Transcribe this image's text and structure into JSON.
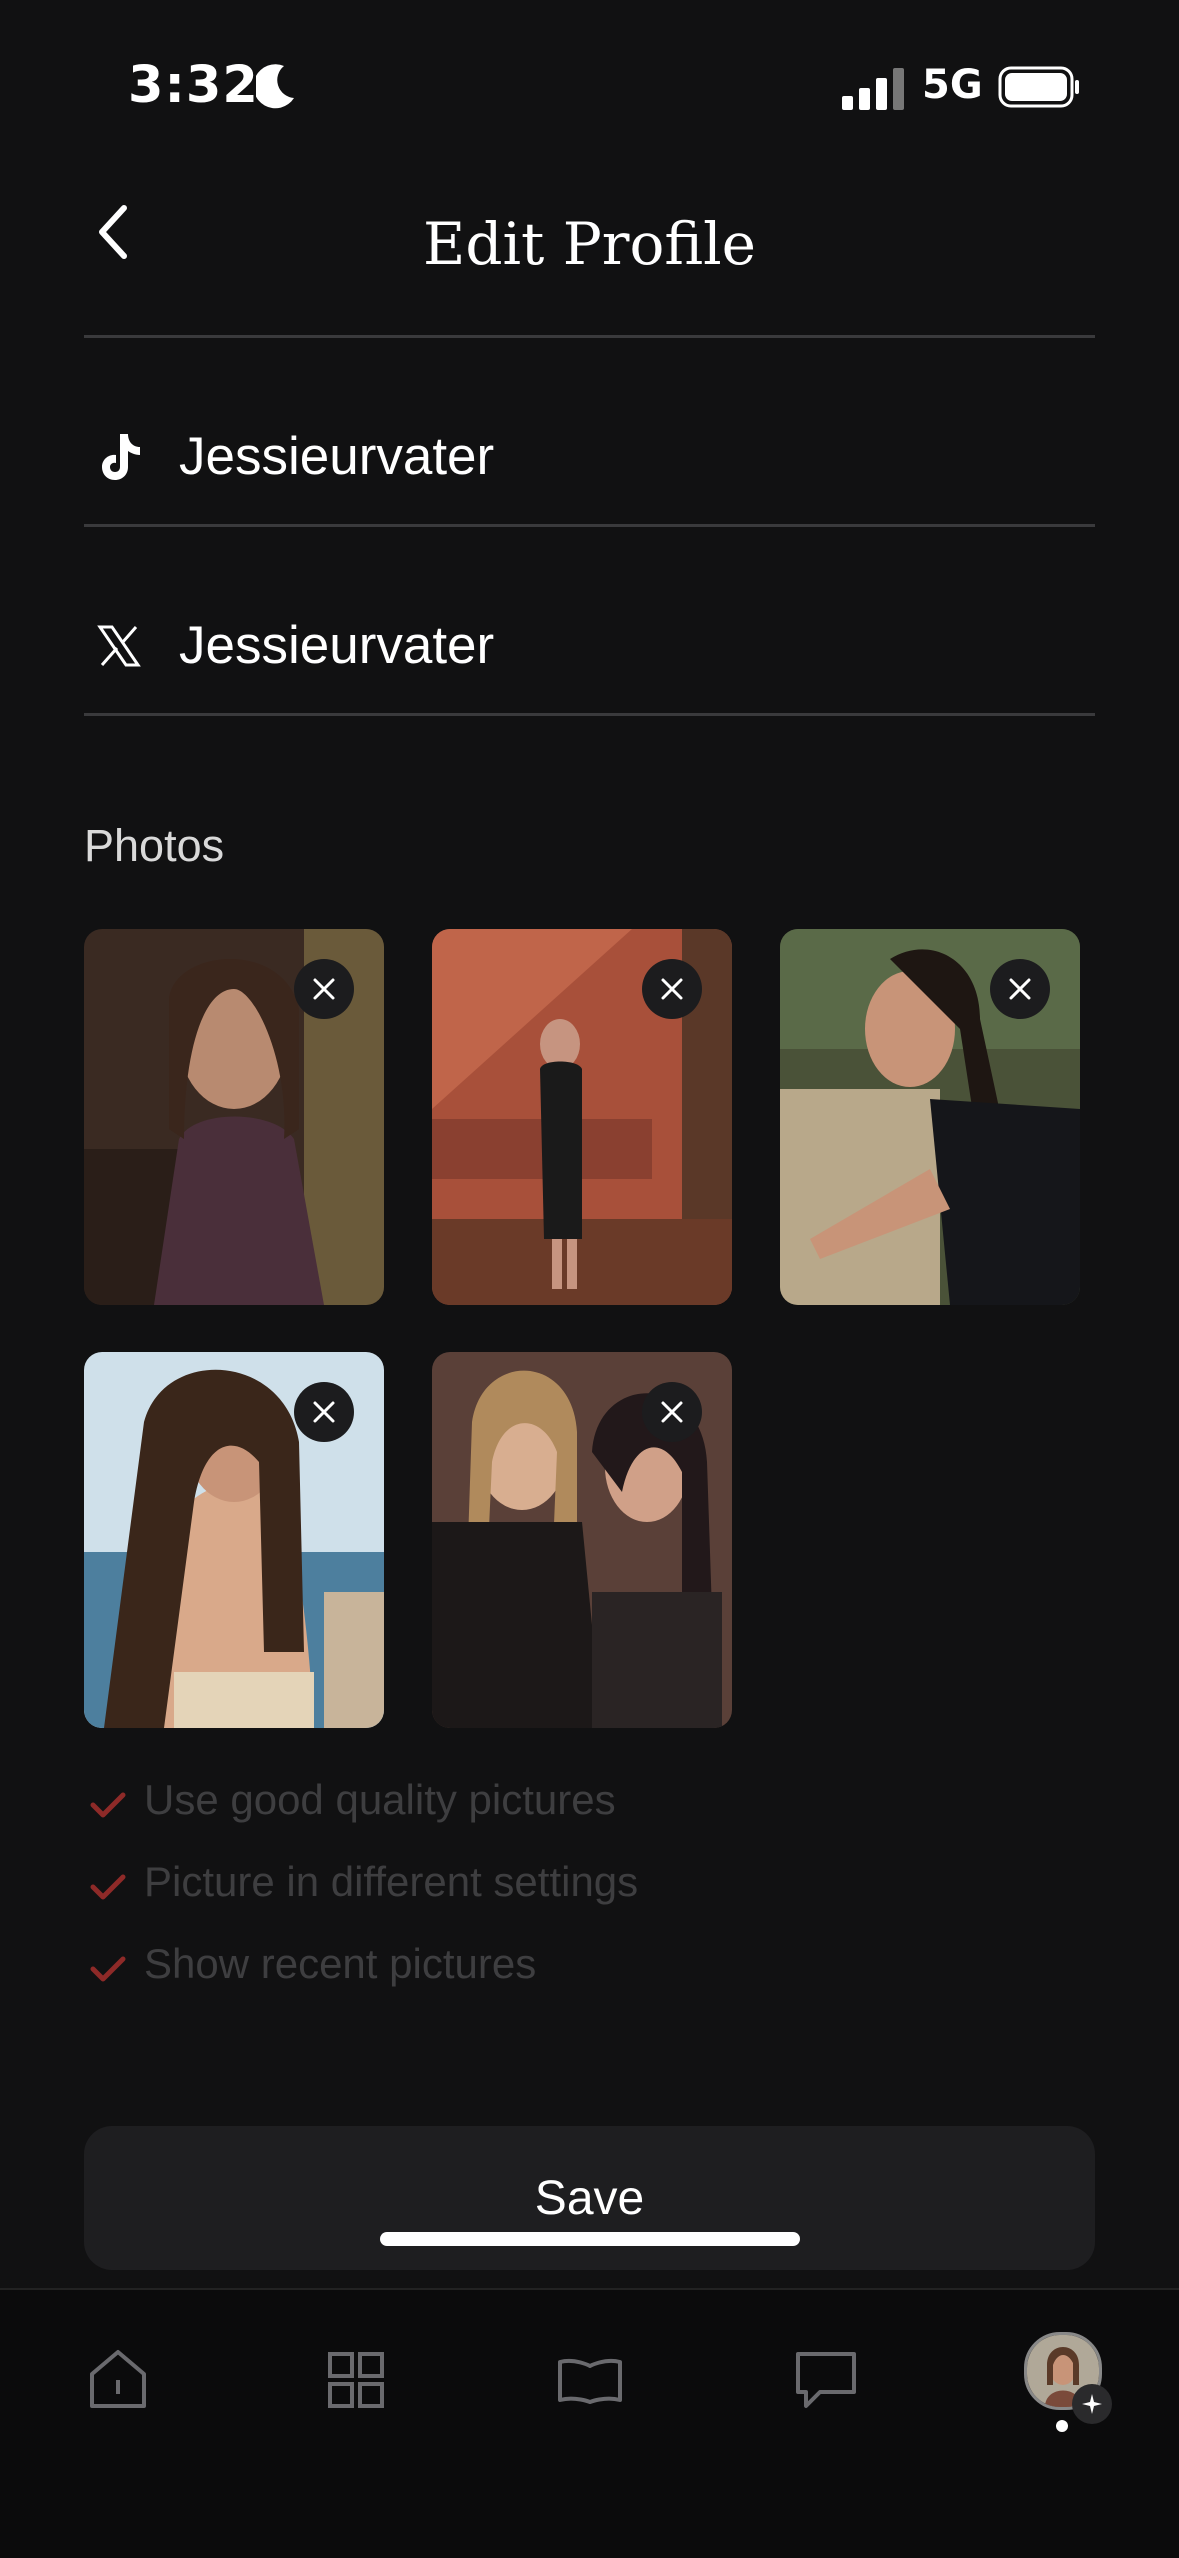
{
  "status_bar": {
    "time": "3:32",
    "network": "5G"
  },
  "header": {
    "title": "Edit Profile"
  },
  "social": {
    "tiktok": {
      "icon": "tiktok-icon",
      "value": "Jessieurvater"
    },
    "x": {
      "icon": "x-icon",
      "value": "Jessieurvater"
    }
  },
  "photos": {
    "label": "Photos",
    "count": 5
  },
  "tips": [
    "Use good quality pictures",
    "Picture in different settings",
    "Show recent pictures"
  ],
  "save_label": "Save",
  "tabbar": {
    "items": [
      "home-icon",
      "grid-icon",
      "map-icon",
      "chat-icon",
      "profile-avatar"
    ],
    "active": "profile-avatar"
  },
  "colors": {
    "background": "#111112",
    "check": "#8e2a28",
    "tip_text": "#3e3e40",
    "button": "#1e1e20"
  }
}
